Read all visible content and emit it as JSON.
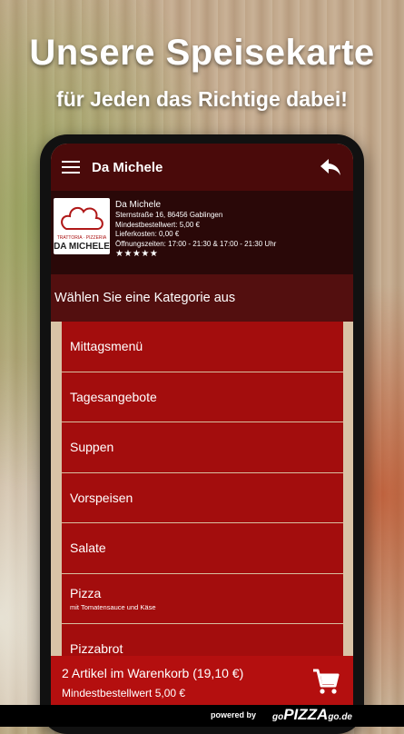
{
  "promo": {
    "headline": "Unsere Speisekarte",
    "subheadline": "für Jeden das Richtige dabei!"
  },
  "appbar": {
    "title": "Da Michele",
    "menu_icon": "hamburger-menu-icon",
    "back_icon": "back-arrow-icon"
  },
  "restaurant": {
    "logo_sub": "TRATTORIA · PIZZERIA",
    "logo_name": "DA MICHELE",
    "name": "Da Michele",
    "address": "Sternstraße 16, 86456 Gablingen",
    "min_order": "Mindestbestellwert: 5,00 €",
    "delivery": "Lieferkosten: 0,00 €",
    "hours": "Öffnungszeiten: 17:00 - 21:30 & 17:00 - 21:30 Uhr",
    "stars": "★★★★★",
    "rating": 5
  },
  "category_prompt": "Wählen Sie eine Kategorie aus",
  "categories": [
    {
      "label": "Mittagsmenü",
      "desc": ""
    },
    {
      "label": "Tagesangebote",
      "desc": ""
    },
    {
      "label": "Suppen",
      "desc": ""
    },
    {
      "label": "Vorspeisen",
      "desc": ""
    },
    {
      "label": "Salate",
      "desc": ""
    },
    {
      "label": "Pizza",
      "desc": "mit Tomatensauce und Käse"
    },
    {
      "label": "Pizzabrot",
      "desc": ""
    }
  ],
  "cart": {
    "summary": "2 Artikel im Warenkorb (19,10 €)",
    "min_order": "Mindestbestellwert 5,00 €",
    "icon": "shopping-cart-icon"
  },
  "footer": {
    "powered_by": "powered by",
    "brand_prefix": "go",
    "brand_main": "PIZZA",
    "brand_suffix": "go",
    "brand_tld": ".de"
  },
  "colors": {
    "appbar": "#4a0a0a",
    "category": "#a30d0d",
    "cart": "#b40f0f"
  }
}
